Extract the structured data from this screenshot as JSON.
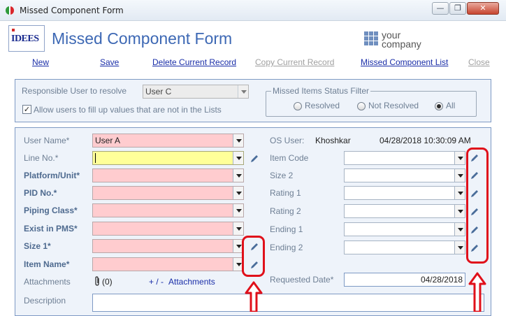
{
  "window": {
    "title": "Missed Component Form",
    "controls": [
      "—",
      "❐",
      "✕"
    ]
  },
  "header": {
    "logo_text": "IDEES",
    "title": "Missed Component Form",
    "company_line1": "your",
    "company_line2": "company"
  },
  "toolbar": {
    "new": "New",
    "save": "Save",
    "delete": "Delete Current Record",
    "copy": "Copy Current Record",
    "list": "Missed Component List",
    "close": "Close"
  },
  "top_panel": {
    "responsible_label": "Responsible User to resolve",
    "responsible_value": "User C",
    "allow_label": "Allow users to fill up values that are not in the Lists",
    "allow_checked": true,
    "filter_title": "Missed Items Status Filter",
    "filter_options": [
      "Resolved",
      "Not Resolved",
      "All"
    ],
    "filter_selected": "All"
  },
  "form": {
    "left_fields": [
      {
        "label": "User Name*",
        "value": "User A"
      },
      {
        "label": "Line No.*",
        "value": ""
      },
      {
        "label": "Platform/Unit*",
        "value": ""
      },
      {
        "label": "PID No.*",
        "value": ""
      },
      {
        "label": "Piping Class*",
        "value": ""
      },
      {
        "label": "Exist in PMS*",
        "value": ""
      },
      {
        "label": "Size 1*",
        "value": ""
      },
      {
        "label": "Item Name*",
        "value": ""
      }
    ],
    "os_user_label": "OS User:",
    "os_user_value": "Khoshkar",
    "timestamp": "04/28/2018 10:30:09 AM",
    "right_fields": [
      {
        "label": "Item Code",
        "value": ""
      },
      {
        "label": "Size 2",
        "value": ""
      },
      {
        "label": "Rating 1",
        "value": ""
      },
      {
        "label": "Rating 2",
        "value": ""
      },
      {
        "label": "Ending 1",
        "value": ""
      },
      {
        "label": "Ending 2",
        "value": ""
      }
    ],
    "attachments_label": "Attachments",
    "attachments_count": "(0)",
    "attachments_plusminus": "+ / -",
    "attachments_link": "Attachments",
    "requested_date_label": "Requested Date*",
    "requested_date_value": "04/28/2018",
    "description_label": "Description"
  },
  "colors": {
    "required_field": "#ffcccf",
    "active_field": "#ffff99",
    "title_blue": "#3d68b4",
    "annotation_red": "#e0101a"
  }
}
